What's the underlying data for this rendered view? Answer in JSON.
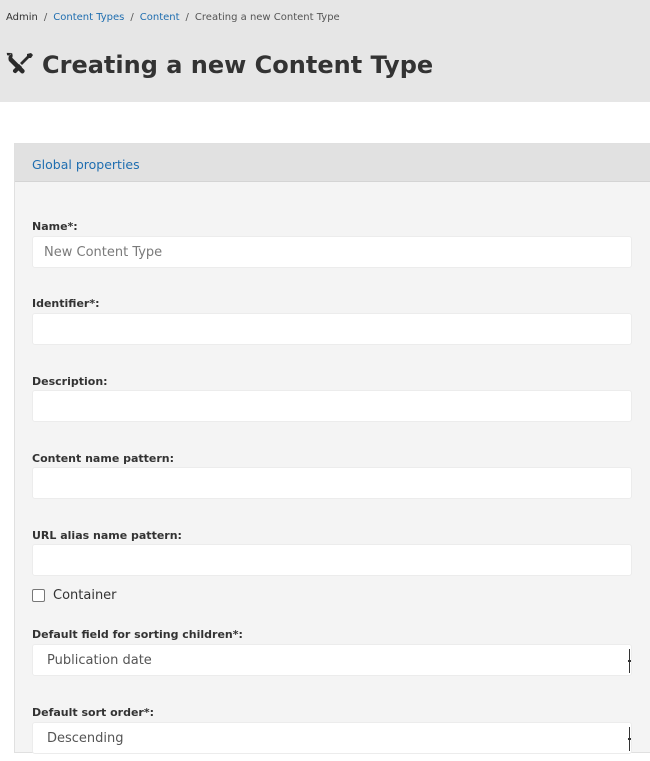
{
  "breadcrumb": {
    "items": [
      {
        "label": "Admin",
        "link": false
      },
      {
        "label": "Content Types",
        "link": true
      },
      {
        "label": "Content",
        "link": true
      },
      {
        "label": "Creating a new Content Type",
        "link": false
      }
    ],
    "separator": "/"
  },
  "page": {
    "title": "Creating a new Content Type",
    "title_icon": "tools-icon"
  },
  "panel": {
    "title": "Global properties"
  },
  "form": {
    "name": {
      "label": "Name*:",
      "value": "",
      "placeholder": "New Content Type"
    },
    "identifier": {
      "label": "Identifier*:",
      "value": "",
      "placeholder": ""
    },
    "description": {
      "label": "Description:",
      "value": "",
      "placeholder": ""
    },
    "content_name_pattern": {
      "label": "Content name pattern:",
      "value": "",
      "placeholder": ""
    },
    "url_alias_name_pattern": {
      "label": "URL alias name pattern:",
      "value": "",
      "placeholder": ""
    },
    "container": {
      "label": "Container",
      "checked": false
    },
    "default_sort_field": {
      "label": "Default field for sorting children*:",
      "value": "Publication date"
    },
    "default_sort_order": {
      "label": "Default sort order*:",
      "value": "Descending"
    }
  },
  "colors": {
    "link": "#1f6eb0",
    "header_bg": "#e6e6e6",
    "panel_bg": "#f4f4f4",
    "panel_header_bg": "#e1e1e1"
  }
}
